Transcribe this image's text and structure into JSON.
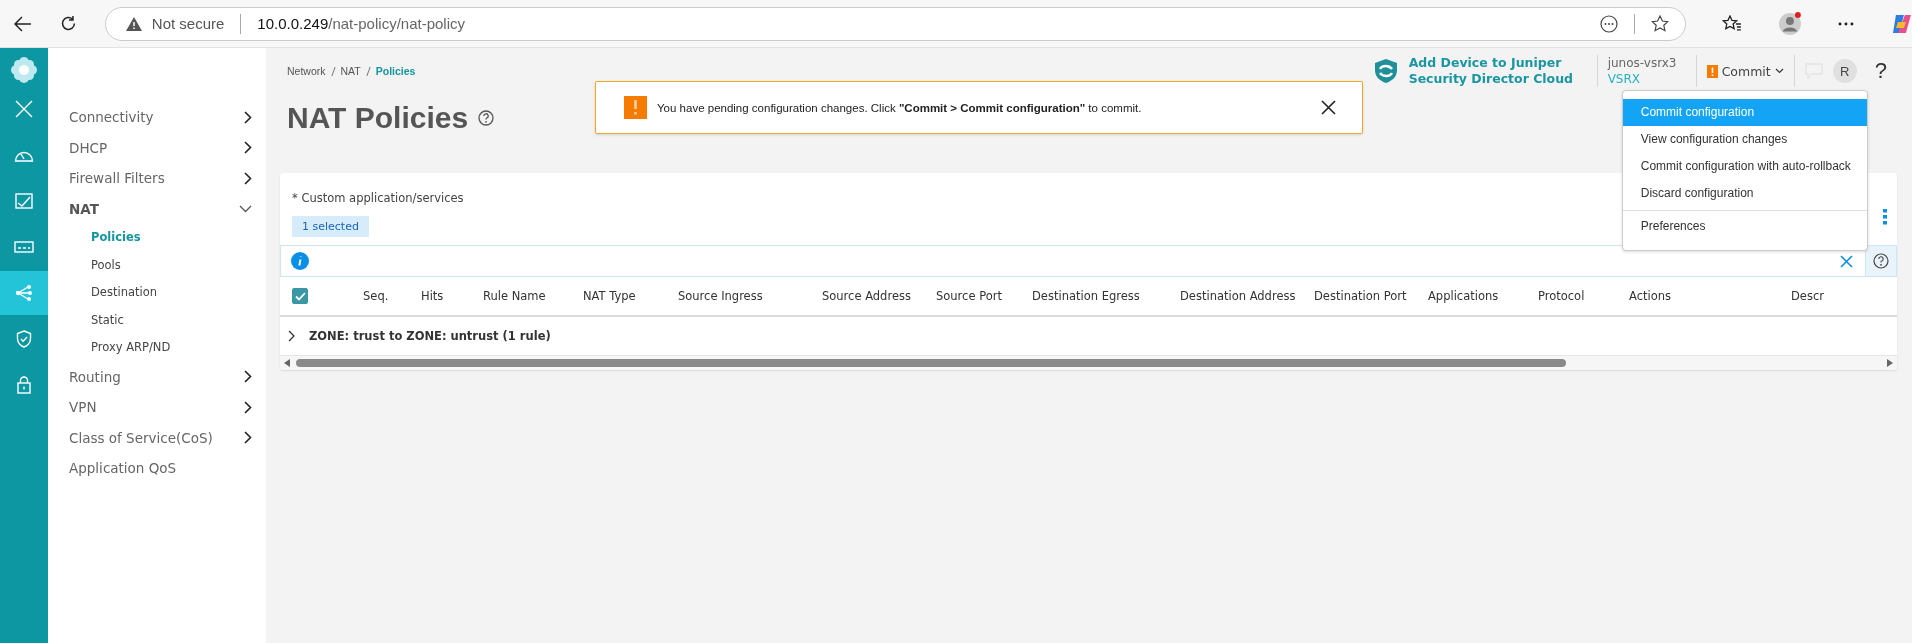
{
  "browser": {
    "security_label": "Not secure",
    "url_host": "10.0.0.249",
    "url_path": "/nat-policy/nat-policy"
  },
  "rail": [
    {
      "kind": "close",
      "selected": false
    },
    {
      "kind": "dashboard",
      "selected": false
    },
    {
      "kind": "monitor",
      "selected": false
    },
    {
      "kind": "device",
      "selected": false
    },
    {
      "kind": "network",
      "selected": true
    },
    {
      "kind": "security",
      "selected": false
    },
    {
      "kind": "lock",
      "selected": false
    }
  ],
  "sidebar": {
    "items": [
      {
        "label": "Connectivity",
        "kind": "group",
        "expanded": false
      },
      {
        "label": "DHCP",
        "kind": "group",
        "expanded": false
      },
      {
        "label": "Firewall Filters",
        "kind": "group",
        "expanded": false
      },
      {
        "label": "NAT",
        "kind": "group",
        "expanded": true,
        "children": [
          {
            "label": "Policies",
            "selected": true
          },
          {
            "label": "Pools",
            "selected": false
          },
          {
            "label": "Destination",
            "selected": false
          },
          {
            "label": "Static",
            "selected": false
          },
          {
            "label": "Proxy ARP/ND",
            "selected": false
          }
        ]
      },
      {
        "label": "Routing",
        "kind": "group",
        "expanded": false
      },
      {
        "label": "VPN",
        "kind": "group",
        "expanded": false
      },
      {
        "label": "Class of Service(CoS)",
        "kind": "group",
        "expanded": false
      },
      {
        "label": "Application QoS",
        "kind": "link",
        "expanded": false
      }
    ]
  },
  "breadcrumb": [
    {
      "label": "Network",
      "selected": false
    },
    {
      "label": "NAT",
      "selected": false
    },
    {
      "label": "Policies",
      "selected": true
    }
  ],
  "page_title": "NAT Policies",
  "toast": {
    "text": "You have pending configuration changes. Click **\"Commit > Commit configuration\"** to commit."
  },
  "header": {
    "promo": "Add Device to Juniper Security Director Cloud",
    "device_name": "junos-vsrx3",
    "device_model": "VSRX",
    "commit_button": "Commit",
    "avatar": "R",
    "help": "?"
  },
  "commit_menu": {
    "items": [
      {
        "label": "Commit configuration",
        "selected": true,
        "divider_before": false
      },
      {
        "label": "View configuration changes",
        "selected": false,
        "divider_before": false
      },
      {
        "label": "Commit configuration with auto-rollback",
        "selected": false,
        "divider_before": false
      },
      {
        "label": "Discard configuration",
        "selected": false,
        "divider_before": false
      },
      {
        "label": "Preferences",
        "selected": false,
        "divider_before": true
      }
    ]
  },
  "card": {
    "note": "* Custom application/services",
    "selection_badge": "1 selected",
    "table": {
      "header_checked": true,
      "columns": [
        "Seq.",
        "Hits",
        "Rule Name",
        "NAT Type",
        "Source Ingress",
        "Source Address",
        "Source Port",
        "Destination Egress",
        "Destination Address",
        "Destination Port",
        "Applications",
        "Protocol",
        "Actions",
        "Descr"
      ],
      "groups": [
        {
          "label": "ZONE: trust to ZONE: untrust (1 rule)",
          "expanded": false
        }
      ]
    }
  }
}
